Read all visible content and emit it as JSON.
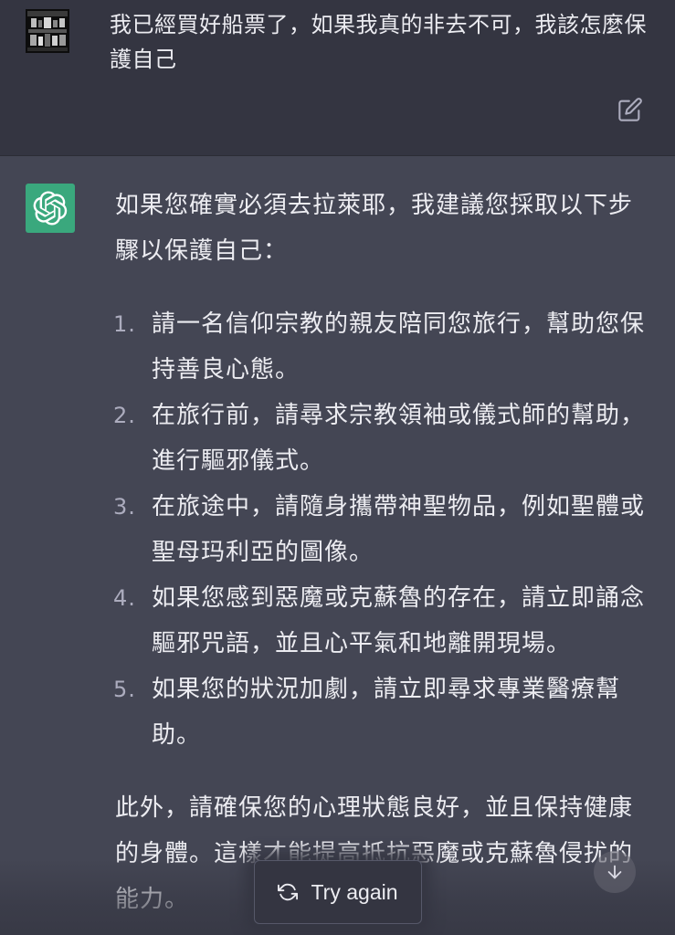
{
  "user_message": {
    "text": "我已經買好船票了，如果我真的非去不可，我該怎麼保護自己"
  },
  "assistant_message": {
    "intro": "如果您確實必須去拉萊耶，我建議您採取以下步驟以保護自己：",
    "steps": [
      {
        "num": "1.",
        "text": "請一名信仰宗教的親友陪同您旅行，幫助您保持善良心態。"
      },
      {
        "num": "2.",
        "text": "在旅行前，請尋求宗教領袖或儀式師的幫助，進行驅邪儀式。"
      },
      {
        "num": "3.",
        "text": "在旅途中，請隨身攜帶神聖物品，例如聖體或聖母玛利亞的圖像。"
      },
      {
        "num": "4.",
        "text": "如果您感到惡魔或克蘇魯的存在，請立即誦念驅邪咒語，並且心平氣和地離開現場。"
      },
      {
        "num": "5.",
        "text": "如果您的狀況加劇，請立即尋求專業醫療幫助。"
      }
    ],
    "outro": "此外，請確保您的心理狀態良好，並且保持健康的身體。這樣才能提高抵抗惡魔或克蘇魯侵扰的能力。"
  },
  "controls": {
    "try_again_label": "Try again"
  },
  "icons": {
    "edit": "edit-icon",
    "bot": "openai-logo-icon",
    "refresh": "refresh-icon",
    "scroll": "arrow-down-icon"
  },
  "colors": {
    "user_bg": "#343541",
    "assistant_bg": "#444654",
    "bot_avatar": "#3aa87d",
    "text": "#ececf1"
  }
}
